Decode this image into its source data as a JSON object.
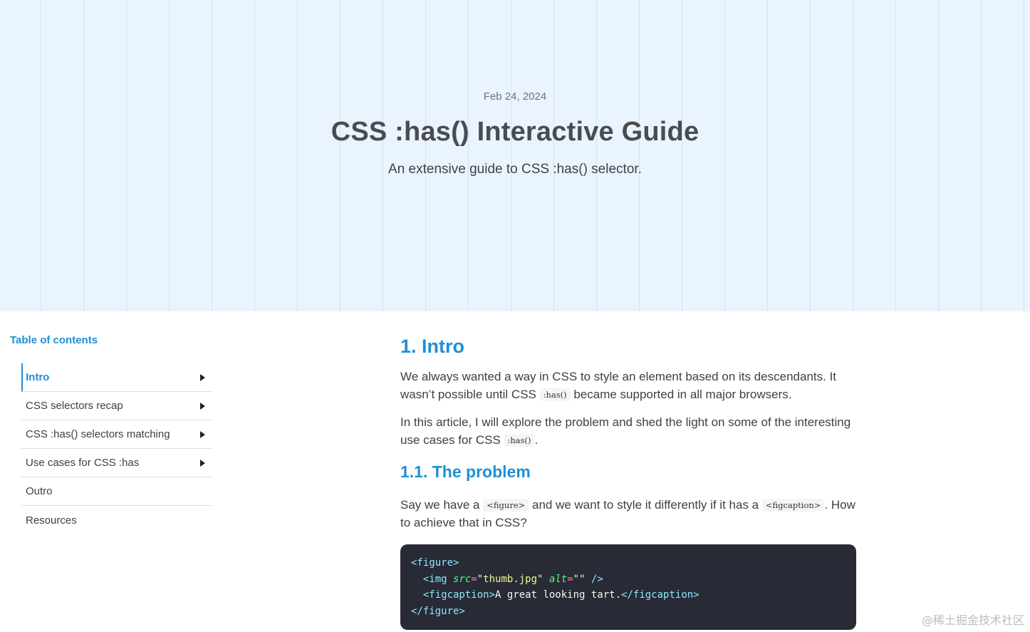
{
  "hero": {
    "date": "Feb 24, 2024",
    "title": "CSS :has() Interactive Guide",
    "subtitle": "An extensive guide to CSS :has() selector."
  },
  "toc": {
    "heading": "Table of contents",
    "items": [
      {
        "label": "Intro",
        "expandable": true,
        "active": true
      },
      {
        "label": "CSS selectors recap",
        "expandable": true
      },
      {
        "label": "CSS :has() selectors matching",
        "expandable": true
      },
      {
        "label": "Use cases for CSS :has",
        "expandable": true
      },
      {
        "label": "Outro",
        "expandable": false
      },
      {
        "label": "Resources",
        "expandable": false
      }
    ]
  },
  "article": {
    "section_title": "1. Intro",
    "p1": {
      "a": "We always wanted a way in CSS to style an element based on its descendants. It wasn’t possible until CSS ",
      "code": ":has()",
      "b": " became supported in all major browsers."
    },
    "p2": {
      "a": "In this article, I will explore the problem and shed the light on some of the interesting use cases for CSS ",
      "code": ":has()",
      "b": "."
    },
    "subsection_title": "1.1. The problem",
    "p3": {
      "a": "Say we have a ",
      "code1": "<figure>",
      "b": " and we want to style it differently if it has a ",
      "code2": "<figcaption>",
      "c": ". How to achieve that in CSS?"
    },
    "code": {
      "l1_tag": "<figure>",
      "l2_indent": "  ",
      "l2_open": "<img",
      "l2_attr1": "src",
      "l2_eq1": "=",
      "l2_val1": "\"thumb.jpg\"",
      "l2_attr2": "alt",
      "l2_eq2": "=",
      "l2_val2": "\"\"",
      "l2_close": "/>",
      "l3_indent": "  ",
      "l3_open": "<figcaption>",
      "l3_text": "A great looking tart.",
      "l3_close": "</figcaption>",
      "l4_tag": "</figure>"
    }
  },
  "watermark": "@稀土掘金技术社区",
  "colors": {
    "accent": "#1f8fd6",
    "hero_bg": "#eaf4fe",
    "code_bg": "#282a36"
  }
}
